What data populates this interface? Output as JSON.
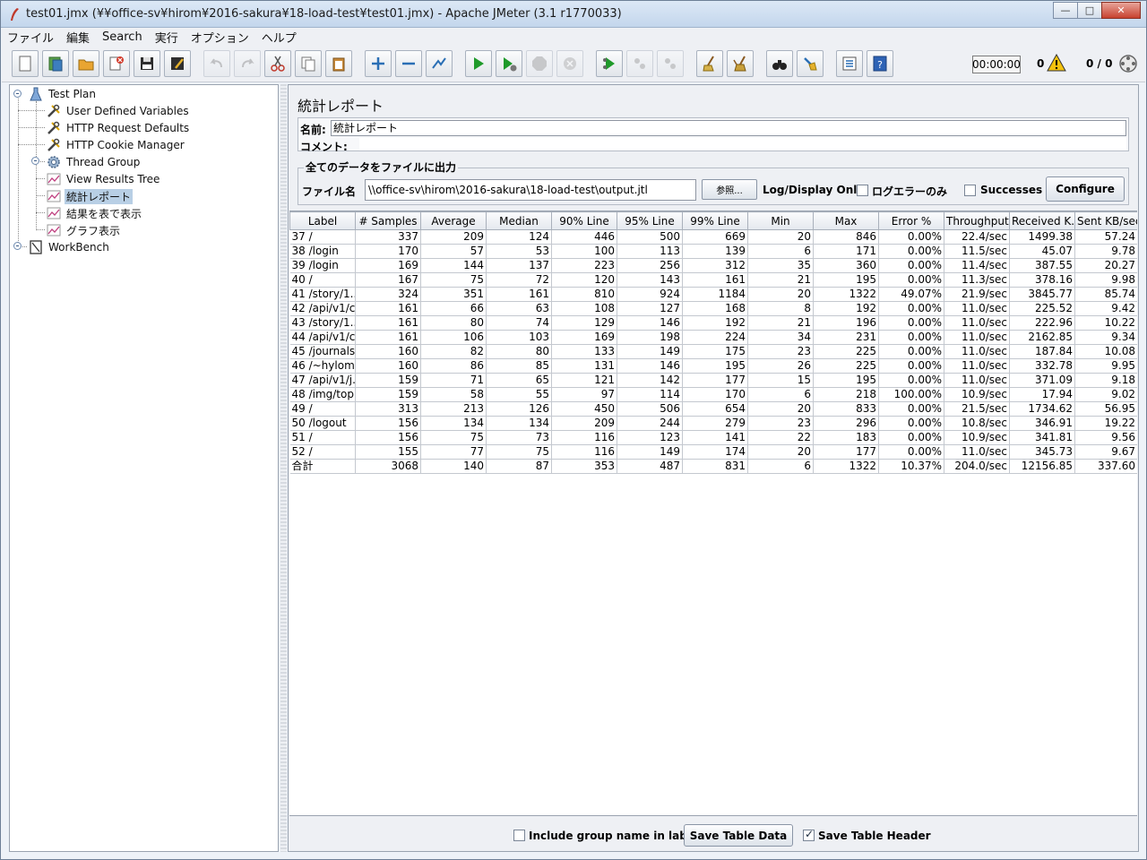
{
  "window": {
    "title": "test01.jmx (¥¥office-sv¥hirom¥2016-sakura¥18-load-test¥test01.jmx) - Apache JMeter (3.1 r1770033)",
    "minimize": "—",
    "maximize": "□",
    "close": "✕"
  },
  "menu": [
    "ファイル",
    "編集",
    "Search",
    "実行",
    "オプション",
    "ヘルプ"
  ],
  "toolbar": {
    "timer": "00:00:00",
    "error_count": "0",
    "threads": "0 / 0"
  },
  "tree": [
    {
      "label": "Test Plan",
      "icon": "test-plan-icon"
    },
    {
      "label": "User Defined Variables",
      "icon": "wrench-icon"
    },
    {
      "label": "HTTP Request Defaults",
      "icon": "wrench-icon"
    },
    {
      "label": "HTTP Cookie Manager",
      "icon": "wrench-icon"
    },
    {
      "label": "Thread Group",
      "icon": "gear-icon"
    },
    {
      "label": "View Results Tree",
      "icon": "chart-icon"
    },
    {
      "label": "統計レポート",
      "icon": "chart-icon"
    },
    {
      "label": "結果を表で表示",
      "icon": "chart-icon"
    },
    {
      "label": "グラフ表示",
      "icon": "chart-icon"
    },
    {
      "label": "WorkBench",
      "icon": "workbench-icon"
    }
  ],
  "panel": {
    "title": "統計レポート",
    "name_label": "名前:",
    "name_value": "統計レポート",
    "comment_label": "コメント:",
    "file_group_title": "全てのデータをファイルに出力",
    "file_label": "ファイル名",
    "file_value": "\\\\office-sv\\hirom\\2016-sakura\\18-load-test\\output.jtl",
    "browse_label": "参照...",
    "log_display_label": "Log/Display Only:",
    "errors_only_label": "ログエラーのみ",
    "successes_label": "Successes",
    "configure_label": "Configure"
  },
  "table": {
    "headers": [
      "Label",
      "# Samples",
      "Average",
      "Median",
      "90% Line",
      "95% Line",
      "99% Line",
      "Min",
      "Max",
      "Error %",
      "Throughput",
      "Received K...",
      "Sent KB/sec"
    ],
    "rows": [
      [
        "37 /",
        "337",
        "209",
        "124",
        "446",
        "500",
        "669",
        "20",
        "846",
        "0.00%",
        "22.4/sec",
        "1499.38",
        "57.24"
      ],
      [
        "38 /login",
        "170",
        "57",
        "53",
        "100",
        "113",
        "139",
        "6",
        "171",
        "0.00%",
        "11.5/sec",
        "45.07",
        "9.78"
      ],
      [
        "39 /login",
        "169",
        "144",
        "137",
        "223",
        "256",
        "312",
        "35",
        "360",
        "0.00%",
        "11.4/sec",
        "387.55",
        "20.27"
      ],
      [
        "40 /",
        "167",
        "75",
        "72",
        "120",
        "143",
        "161",
        "21",
        "195",
        "0.00%",
        "11.3/sec",
        "378.16",
        "9.98"
      ],
      [
        "41 /story/1...",
        "324",
        "351",
        "161",
        "810",
        "924",
        "1184",
        "20",
        "1322",
        "49.07%",
        "21.9/sec",
        "3845.77",
        "85.74"
      ],
      [
        "42 /api/v1/c...",
        "161",
        "66",
        "63",
        "108",
        "127",
        "168",
        "8",
        "192",
        "0.00%",
        "11.0/sec",
        "225.52",
        "9.42"
      ],
      [
        "43 /story/1...",
        "161",
        "80",
        "74",
        "129",
        "146",
        "192",
        "21",
        "196",
        "0.00%",
        "11.0/sec",
        "222.96",
        "10.22"
      ],
      [
        "44 /api/v1/c...",
        "161",
        "106",
        "103",
        "169",
        "198",
        "224",
        "34",
        "231",
        "0.00%",
        "11.0/sec",
        "2162.85",
        "9.34"
      ],
      [
        "45 /journals",
        "160",
        "82",
        "80",
        "133",
        "149",
        "175",
        "23",
        "225",
        "0.00%",
        "11.0/sec",
        "187.84",
        "10.08"
      ],
      [
        "46 /~hylom...",
        "160",
        "86",
        "85",
        "131",
        "146",
        "195",
        "26",
        "225",
        "0.00%",
        "11.0/sec",
        "332.78",
        "9.95"
      ],
      [
        "47 /api/v1/j...",
        "159",
        "71",
        "65",
        "121",
        "142",
        "177",
        "15",
        "195",
        "0.00%",
        "11.0/sec",
        "371.09",
        "9.18"
      ],
      [
        "48 /img/top...",
        "159",
        "58",
        "55",
        "97",
        "114",
        "170",
        "6",
        "218",
        "100.00%",
        "10.9/sec",
        "17.94",
        "9.02"
      ],
      [
        "49 /",
        "313",
        "213",
        "126",
        "450",
        "506",
        "654",
        "20",
        "833",
        "0.00%",
        "21.5/sec",
        "1734.62",
        "56.95"
      ],
      [
        "50 /logout",
        "156",
        "134",
        "134",
        "209",
        "244",
        "279",
        "23",
        "296",
        "0.00%",
        "10.8/sec",
        "346.91",
        "19.22"
      ],
      [
        "51 /",
        "156",
        "75",
        "73",
        "116",
        "123",
        "141",
        "22",
        "183",
        "0.00%",
        "10.9/sec",
        "341.81",
        "9.56"
      ],
      [
        "52 /",
        "155",
        "77",
        "75",
        "116",
        "149",
        "174",
        "20",
        "177",
        "0.00%",
        "11.0/sec",
        "345.73",
        "9.67"
      ],
      [
        "合計",
        "3068",
        "140",
        "87",
        "353",
        "487",
        "831",
        "6",
        "1322",
        "10.37%",
        "204.0/sec",
        "12156.85",
        "337.60"
      ]
    ]
  },
  "bottom": {
    "include_group_label": "Include group name in label?",
    "save_table_label": "Save Table Data",
    "save_header_label": "Save Table Header"
  }
}
